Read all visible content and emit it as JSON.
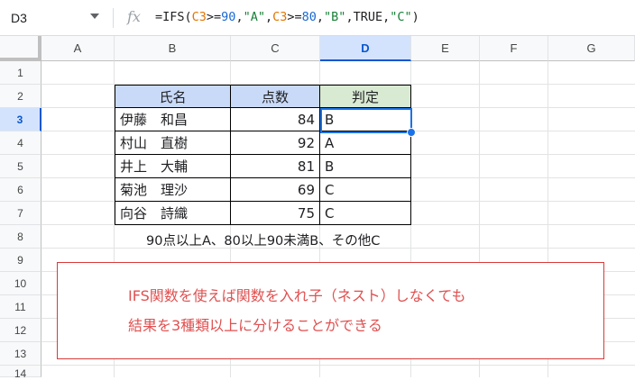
{
  "formula_bar": {
    "name_box": "D3",
    "fx_label": "fx",
    "formula_parts": [
      {
        "text": "=IFS(",
        "kind": "plain"
      },
      {
        "text": "C3",
        "kind": "ref"
      },
      {
        "text": ">=",
        "kind": "plain"
      },
      {
        "text": "90",
        "kind": "num"
      },
      {
        "text": ",",
        "kind": "plain"
      },
      {
        "text": "\"A\"",
        "kind": "str"
      },
      {
        "text": ",",
        "kind": "plain"
      },
      {
        "text": "C3",
        "kind": "ref"
      },
      {
        "text": ">=",
        "kind": "plain"
      },
      {
        "text": "80",
        "kind": "num"
      },
      {
        "text": ",",
        "kind": "plain"
      },
      {
        "text": "\"B\"",
        "kind": "str"
      },
      {
        "text": ",TRUE,",
        "kind": "plain"
      },
      {
        "text": "\"C\"",
        "kind": "str"
      },
      {
        "text": ")",
        "kind": "plain"
      }
    ]
  },
  "grid": {
    "columns": [
      "A",
      "B",
      "C",
      "D",
      "E",
      "F",
      "G"
    ],
    "selected_column": "D",
    "rows": [
      "1",
      "2",
      "3",
      "4",
      "5",
      "6",
      "7",
      "8",
      "9",
      "10",
      "11",
      "12",
      "13",
      "14"
    ],
    "selected_row": "3"
  },
  "table": {
    "headers": [
      "氏名",
      "点数",
      "判定"
    ],
    "rows": [
      {
        "name": "伊藤　和昌",
        "score": "84",
        "grade": "B"
      },
      {
        "name": "村山　直樹",
        "score": "92",
        "grade": "A"
      },
      {
        "name": "井上　大輔",
        "score": "81",
        "grade": "B"
      },
      {
        "name": "菊池　理沙",
        "score": "69",
        "grade": "C"
      },
      {
        "name": "向谷　詩織",
        "score": "75",
        "grade": "C"
      }
    ]
  },
  "note": "90点以上A、80以上90未満B、その他C",
  "callout": {
    "line1": "IFS関数を使えば関数を入れ子（ネスト）しなくても",
    "line2": "結果を3種類以上に分けることができる"
  },
  "colors": {
    "header_blue": "#c9daf8",
    "header_green": "#d9ead3",
    "selection": "#1a73e8",
    "callout_text": "#e05050",
    "callout_border": "#d83a3a"
  }
}
